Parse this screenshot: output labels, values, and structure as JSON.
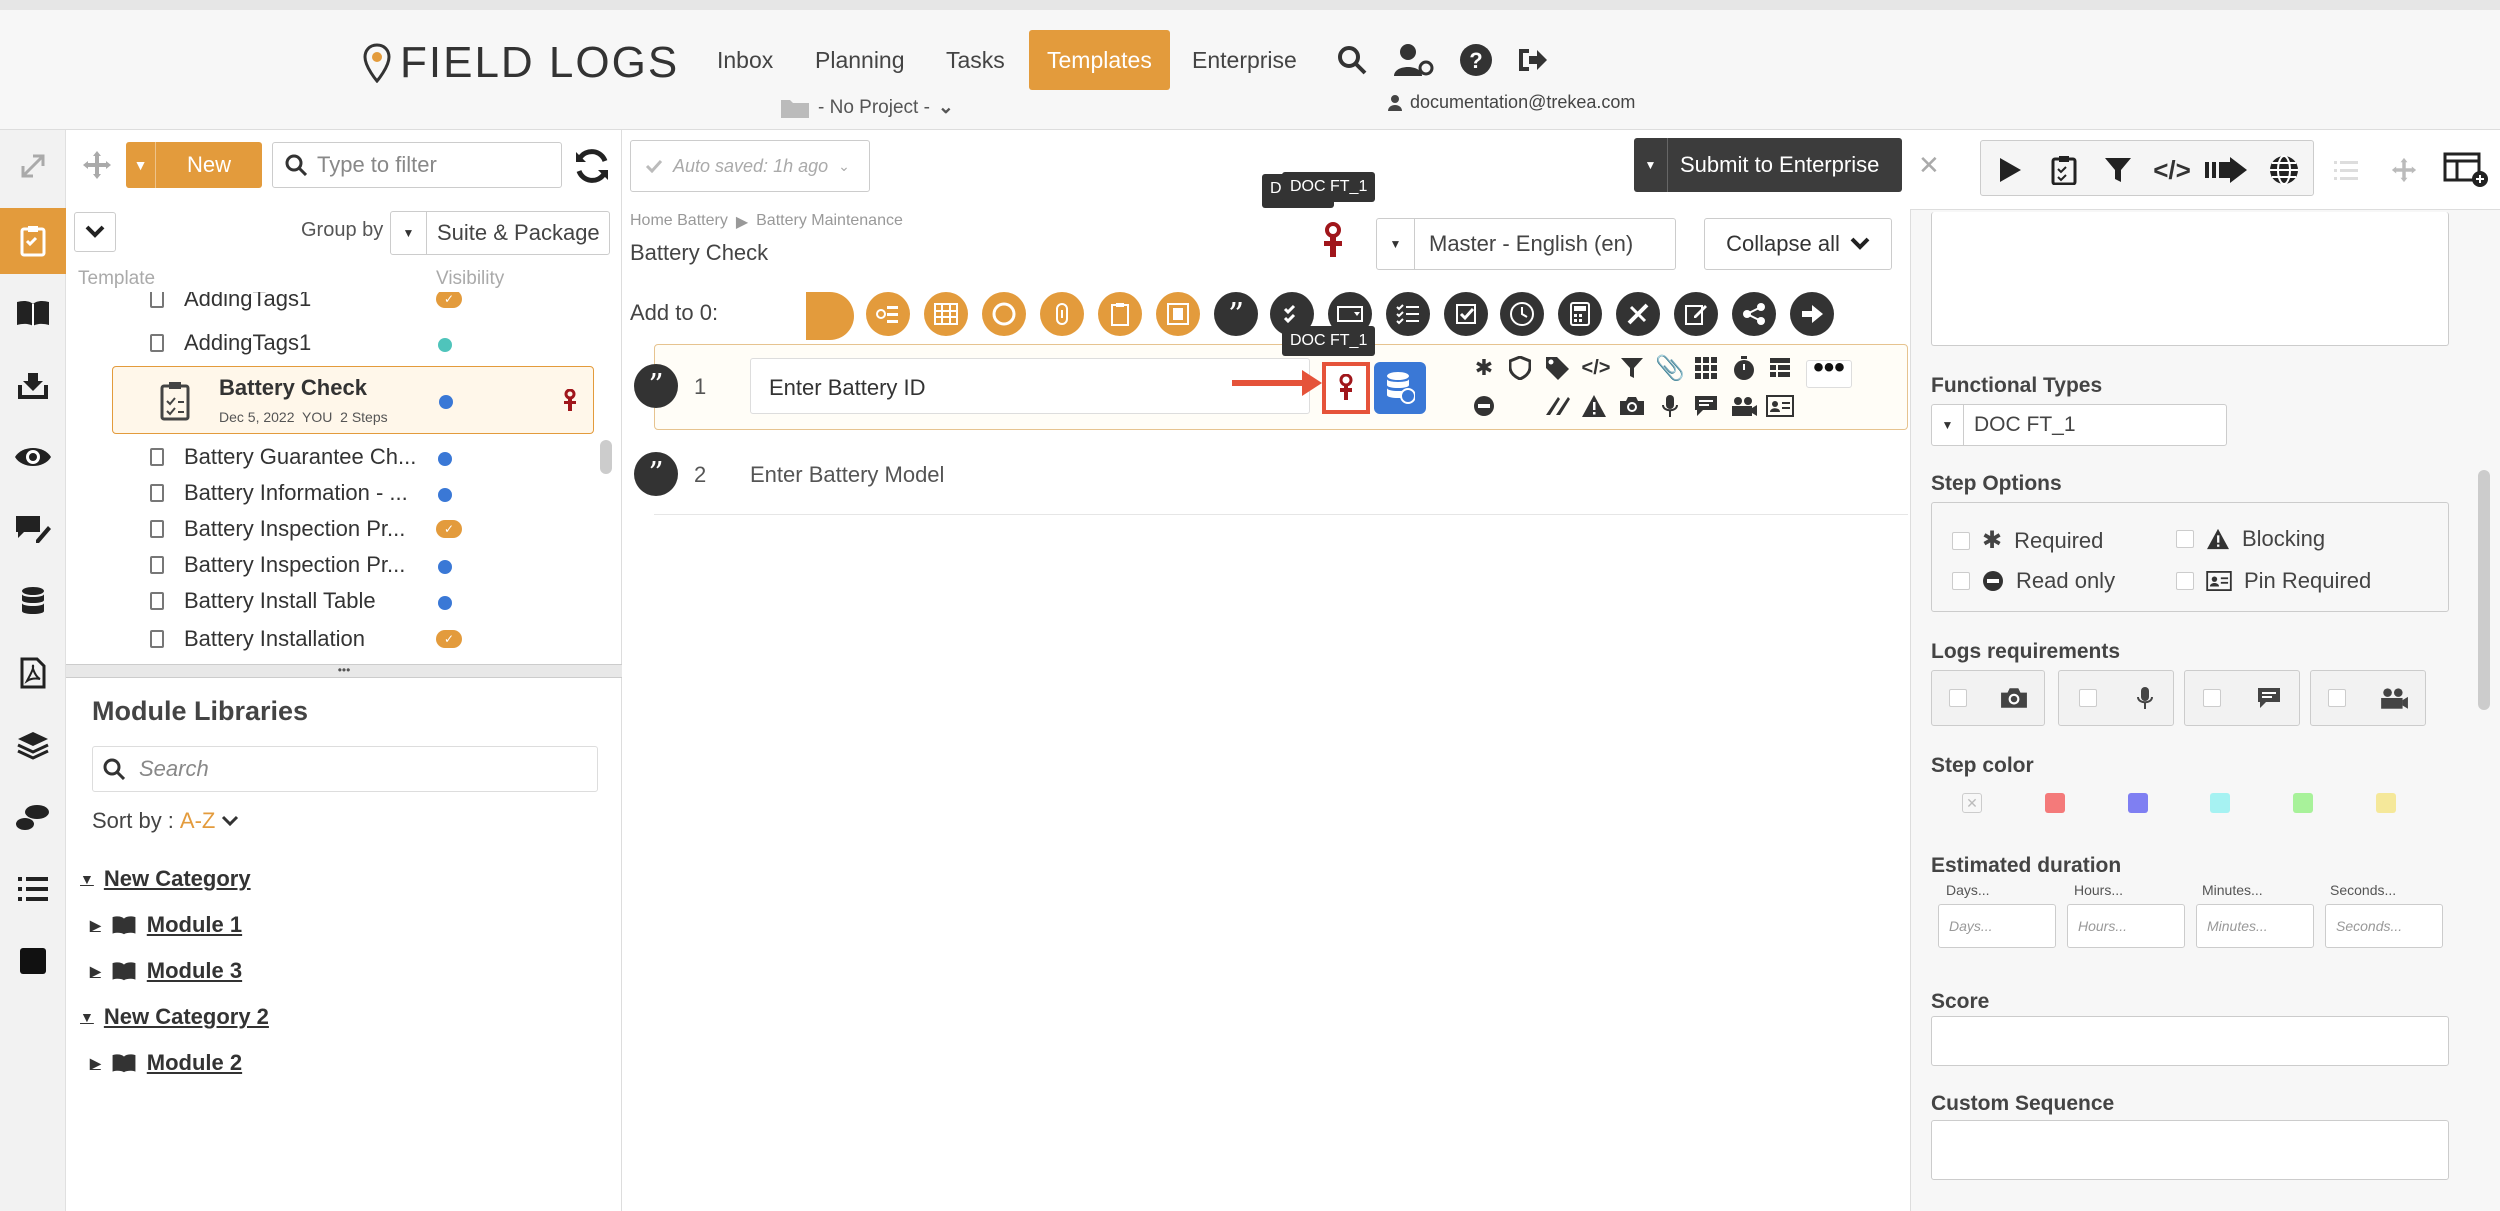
{
  "header": {
    "logo": "FIELD LOGS",
    "nav": [
      "Inbox",
      "Planning",
      "Tasks",
      "Templates",
      "Enterprise"
    ],
    "active_nav": "Templates",
    "project": "- No Project -",
    "user_email": "documentation@trekea.com"
  },
  "left_toolbar": {
    "new_label": "New",
    "filter_placeholder": "Type to filter",
    "group_by_label": "Group by",
    "group_by_value": "Suite & Package",
    "col_template": "Template",
    "col_visibility": "Visibility"
  },
  "templates": [
    {
      "name": "AddingTags1",
      "status": "check"
    },
    {
      "name": "AddingTags1",
      "status": "teal"
    },
    {
      "name": "Battery Check",
      "status": "blue",
      "selected": true,
      "meta": "Dec 5, 2022  YOU  2 Steps"
    },
    {
      "name": "Battery Guarantee Ch...",
      "status": "blue"
    },
    {
      "name": "Battery Information - ...",
      "status": "blue"
    },
    {
      "name": "Battery Inspection Pr...",
      "status": "check"
    },
    {
      "name": "Battery Inspection Pr...",
      "status": "blue"
    },
    {
      "name": "Battery Install Table",
      "status": "blue"
    },
    {
      "name": "Battery Installation",
      "status": "check"
    }
  ],
  "modules": {
    "title": "Module Libraries",
    "search_placeholder": "Search",
    "sort_label": "Sort by :",
    "sort_value": "A-Z",
    "tree": [
      {
        "label": "New Category",
        "type": "category"
      },
      {
        "label": "Module 1",
        "type": "module"
      },
      {
        "label": "Module 3",
        "type": "module"
      },
      {
        "label": "New Category 2",
        "type": "category"
      },
      {
        "label": "Module 2",
        "type": "module"
      }
    ]
  },
  "editor": {
    "autosave": "Auto saved: 1h ago",
    "submit_label": "Submit to Enterprise",
    "breadcrumb_1": "Home Battery",
    "breadcrumb_2": "Battery Maintenance",
    "title": "Battery Check",
    "language": "Master - English (en)",
    "collapse_label": "Collapse all",
    "add_to_label": "Add to 0:",
    "tooltip_doc": "DOC FT_1",
    "tooltip_prefix": "D",
    "steps": [
      {
        "num": "1",
        "text": "Enter Battery ID"
      },
      {
        "num": "2",
        "text": "Enter Battery Model"
      }
    ]
  },
  "right_panel": {
    "functional_types_label": "Functional Types",
    "functional_type_value": "DOC FT_1",
    "step_options_label": "Step Options",
    "options": [
      "Required",
      "Blocking",
      "Read only",
      "Pin Required"
    ],
    "logs_label": "Logs requirements",
    "step_color_label": "Step color",
    "step_colors": [
      "#ffffff",
      "#f47a7a",
      "#7f7ff2",
      "#a6f2f2",
      "#a8f29a",
      "#f5e89a"
    ],
    "duration_label": "Estimated duration",
    "duration_fields": [
      "Days...",
      "Hours...",
      "Minutes...",
      "Seconds..."
    ],
    "score_label": "Score",
    "custom_sequence_label": "Custom Sequence"
  }
}
